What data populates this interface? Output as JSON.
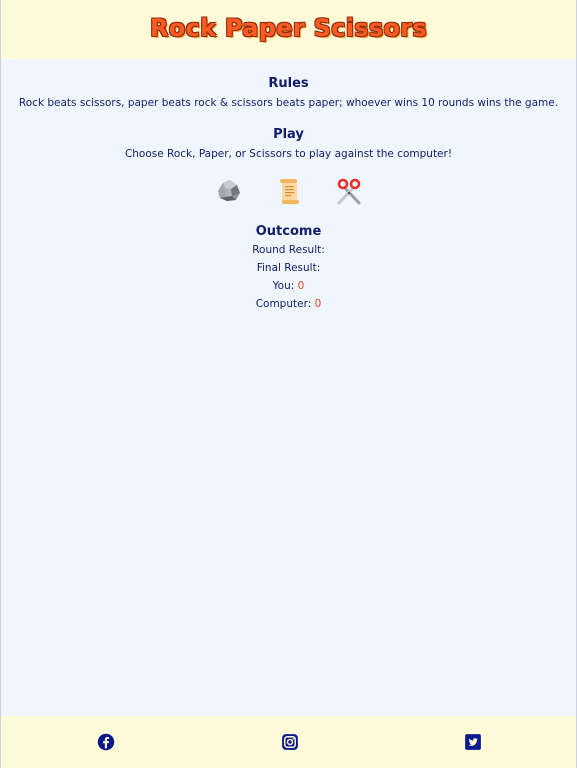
{
  "header": {
    "title": "Rock Paper Scissors"
  },
  "rules": {
    "heading": "Rules",
    "text": "Rock beats scissors, paper beats rock & scissors beats paper; whoever wins 10 rounds wins the game."
  },
  "play": {
    "heading": "Play",
    "text": "Choose Rock, Paper, or Scissors to play against the computer!",
    "choices": [
      {
        "name": "rock",
        "icon": "rock-icon"
      },
      {
        "name": "paper",
        "icon": "paper-scroll-icon"
      },
      {
        "name": "scissors",
        "icon": "scissors-icon"
      }
    ]
  },
  "outcome": {
    "heading": "Outcome",
    "round_result_label": "Round Result:",
    "round_result_value": "",
    "final_result_label": "Final Result:",
    "final_result_value": "",
    "you_label": "You:",
    "you_score": "0",
    "computer_label": "Computer:",
    "computer_score": "0"
  },
  "footer": {
    "social": [
      {
        "name": "facebook",
        "icon": "facebook-icon"
      },
      {
        "name": "instagram",
        "icon": "instagram-icon"
      },
      {
        "name": "twitter",
        "icon": "twitter-icon"
      }
    ]
  },
  "colors": {
    "header_bg": "#fffbd9",
    "body_bg": "#f0f6ff",
    "title": "#ff5a1f",
    "text": "#101d6b",
    "score": "#e8411d",
    "footer_icons": "#0a1a8c"
  }
}
